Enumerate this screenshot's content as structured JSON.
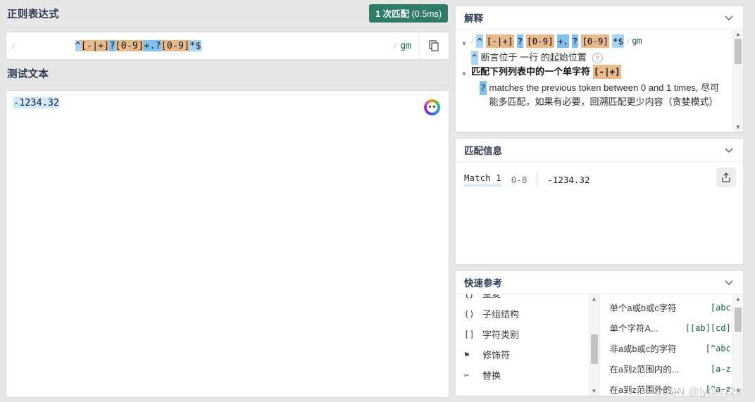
{
  "left": {
    "regex_section_title": "正则表达式",
    "match_badge": {
      "count_text": "1 次匹配",
      "time_text": "(0.5ms)",
      "color": "#2f7a68"
    },
    "regex": {
      "delimiter": "/",
      "tokens": [
        {
          "text": "^",
          "kind": "anch"
        },
        {
          "text": "[-|+]",
          "kind": "cls"
        },
        {
          "text": "?",
          "kind": "quan"
        },
        {
          "text": "[0-9]",
          "kind": "cls"
        },
        {
          "text": "+.",
          "kind": "quan"
        },
        {
          "text": "?",
          "kind": "quan"
        },
        {
          "text": "[0-9]",
          "kind": "cls"
        },
        {
          "text": "*$",
          "kind": "anch"
        }
      ],
      "plain": "^[-|+]?[0-9]+.?[0-9]*$",
      "flags": "gm"
    },
    "copy_icon": "copy-icon",
    "test_section_title": "测试文本",
    "test_text": "-1234.32",
    "ai_icon": "ai-assistant-icon"
  },
  "explain": {
    "title": "解释",
    "collapse_icon": "chevron-down-icon",
    "regex_line_flags": "gm",
    "rows": [
      {
        "kind": "regex",
        "tokens": [
          {
            "text": "^",
            "kind": "anch"
          },
          {
            "text": "[-|+]",
            "kind": "cls"
          },
          {
            "text": "?",
            "kind": "quan"
          },
          {
            "text": "[0-9]",
            "kind": "cls"
          },
          {
            "text": "+.",
            "kind": "quan"
          },
          {
            "text": "?",
            "kind": "quan"
          },
          {
            "text": "[0-9]",
            "kind": "cls"
          },
          {
            "text": "*$",
            "kind": "anch"
          }
        ]
      },
      {
        "kind": "desc",
        "token": "^",
        "token_kind": "anch",
        "text": "断言位于 一行 的起始位置",
        "help": true
      },
      {
        "kind": "desc_bold",
        "text": "匹配下列列表中的一个单字符",
        "token": "[-|+]",
        "token_kind": "cls",
        "triangle": true
      },
      {
        "kind": "desc_multi",
        "token": "?",
        "token_kind": "quan",
        "text": "matches the previous token between 0 and 1 times, 尽可能多匹配，如果有必要，回溯匹配更少内容（贪婪模式）"
      }
    ],
    "scrollbar": {
      "up_icon": "scroll-up-arrow",
      "down_icon": "scroll-down-arrow"
    }
  },
  "match_info": {
    "title": "匹配信息",
    "collapse_icon": "chevron-down-icon",
    "match_label": "Match 1",
    "range": "0-8",
    "value": "-1234.32",
    "share_icon": "export-icon"
  },
  "quick_ref": {
    "title": "快速参考",
    "collapse_icon": "chevron-down-icon",
    "left_items": [
      {
        "icon": "{}",
        "label": "重复"
      },
      {
        "icon": "()",
        "label": "子组结构"
      },
      {
        "icon": "[]",
        "label": "字符类别"
      },
      {
        "icon": "⚑",
        "label": "修饰符"
      },
      {
        "icon": "✂",
        "label": "替换"
      }
    ],
    "right_items": [
      {
        "label": "单个a或b或c字符",
        "code": "[abc]"
      },
      {
        "label": "单个字符A...",
        "code": "[[ab][cd]]"
      },
      {
        "label": "非a或b或c的字符",
        "code": "[^abc]"
      },
      {
        "label": "在a到z范围内的...",
        "code": "[a-z]"
      },
      {
        "label": "在a到z范围外的...",
        "code": "[^a-z]"
      }
    ]
  },
  "watermark": "CSDN @lytao123"
}
